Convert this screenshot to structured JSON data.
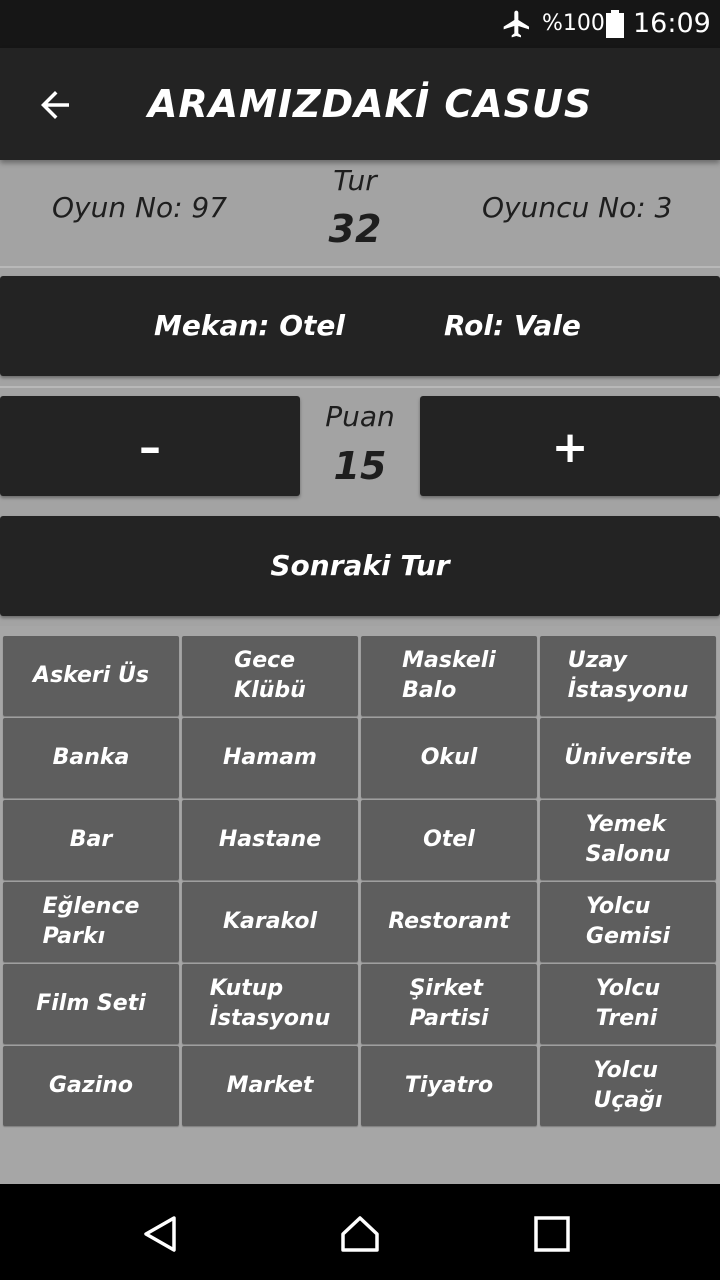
{
  "status_bar": {
    "battery": "%100",
    "time": "16:09",
    "icons": [
      "airplane-mode-icon",
      "battery-full-icon"
    ]
  },
  "app_bar": {
    "title": "ARAMIZDAKİ CASUS",
    "back_icon": "arrow-left-icon"
  },
  "info": {
    "game_no": "Oyun No: 97",
    "tur_label": "Tur",
    "tur_value": "32",
    "player_no": "Oyuncu No: 3"
  },
  "role_card": {
    "place": "Mekan: Otel",
    "role": "Rol: Vale"
  },
  "score": {
    "minus_label": "–",
    "label": "Puan",
    "value": "15",
    "plus_label": "+"
  },
  "next_round_label": "Sonraki Tur",
  "locations": [
    "Askeri Üs",
    "Gece\nKlübü",
    "Maskeli\nBalo",
    "Uzay\nİstasyonu",
    "Banka",
    "Hamam",
    "Okul",
    "Üniversite",
    "Bar",
    "Hastane",
    "Otel",
    "Yemek\nSalonu",
    "Eğlence\nParkı",
    "Karakol",
    "Restorant",
    "Yolcu\nGemisi",
    "Film Seti",
    "Kutup\nİstasyonu",
    "Şirket\nPartisi",
    "Yolcu\nTreni",
    "Gazino",
    "Market",
    "Tiyatro",
    "Yolcu\nUçağı"
  ],
  "nav_bar": {
    "icons": [
      "back-triangle-icon",
      "home-icon",
      "recent-apps-icon"
    ]
  },
  "colors": {
    "background": "#a3a3a3",
    "dark_surface": "#232323",
    "cell": "#5e5e5e",
    "text_light": "#ffffff",
    "text_dark": "#1e1e1e"
  }
}
